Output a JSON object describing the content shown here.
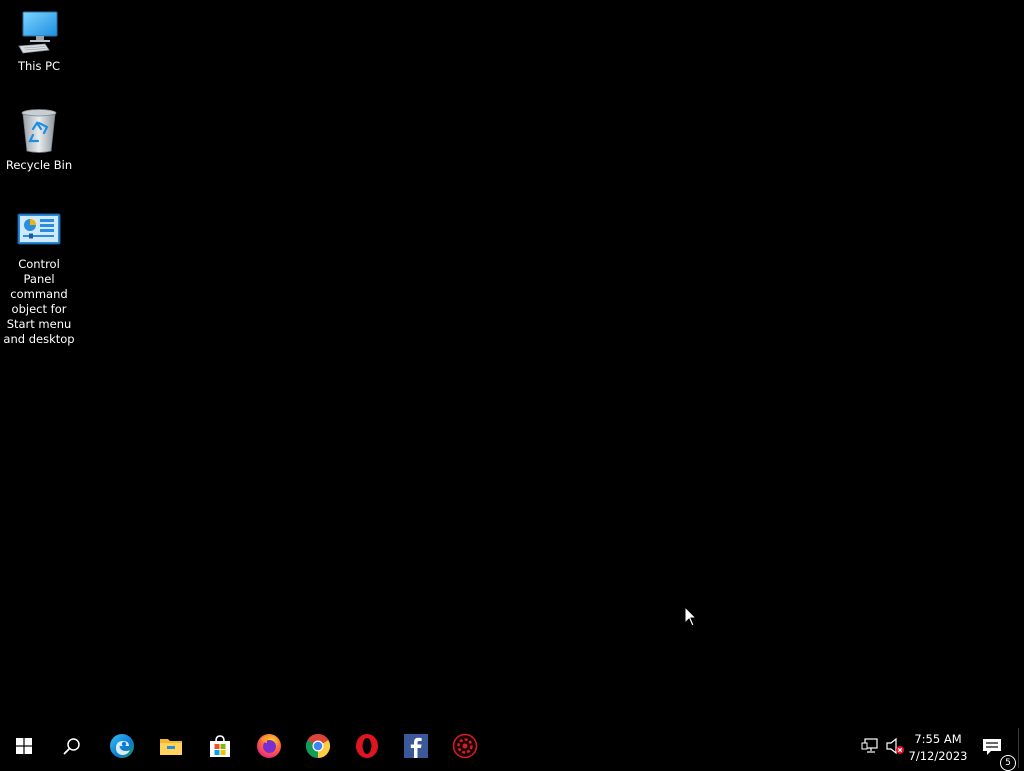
{
  "desktop": {
    "icons": [
      {
        "label": "This PC",
        "icon": "computer-icon"
      },
      {
        "label": "Recycle Bin",
        "icon": "recycle-bin-icon"
      },
      {
        "label": "Control Panel command object for Start menu and desktop",
        "icon": "control-panel-icon"
      }
    ]
  },
  "taskbar": {
    "pinned": [
      {
        "icon": "windows-start-icon"
      },
      {
        "icon": "search-icon"
      },
      {
        "icon": "edge-icon"
      },
      {
        "icon": "file-explorer-icon"
      },
      {
        "icon": "microsoft-store-icon"
      },
      {
        "icon": "firefox-icon"
      },
      {
        "icon": "chrome-icon"
      },
      {
        "icon": "opera-icon"
      },
      {
        "icon": "facebook-icon"
      },
      {
        "icon": "settings-gear-app-icon"
      }
    ],
    "tray": {
      "network_icon": "network-icon",
      "volume_icon": "volume-muted-icon",
      "time": "7:55 AM",
      "date": "7/12/2023",
      "notification_count": "5"
    }
  },
  "colors": {
    "background": "#000000",
    "accent_blue": "#0078d7",
    "opera_red": "#e0161f",
    "facebook_blue": "#3b5998"
  }
}
